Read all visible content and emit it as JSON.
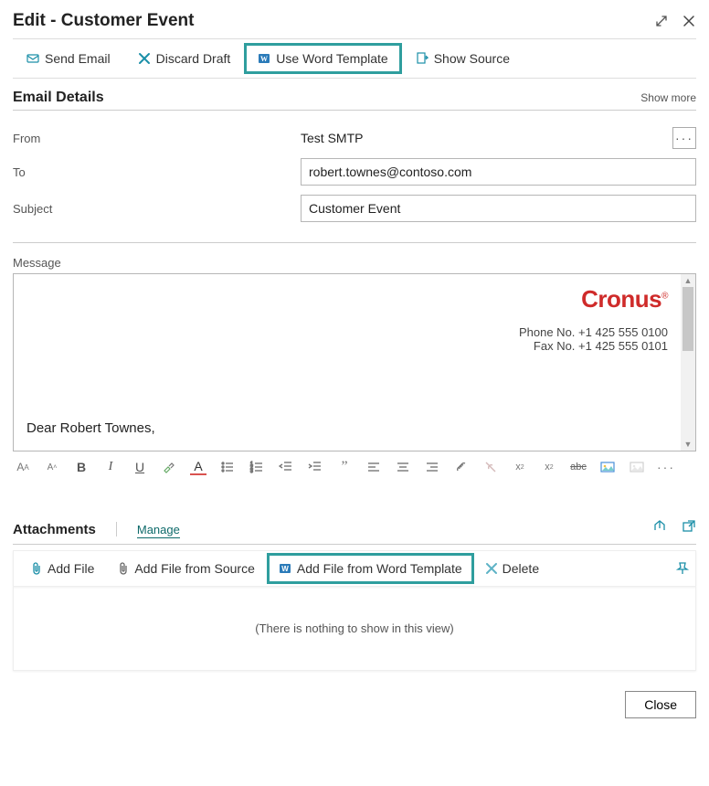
{
  "header": {
    "title": "Edit - Customer Event"
  },
  "toolbar": {
    "send_email": "Send Email",
    "discard_draft": "Discard Draft",
    "use_word_template": "Use Word Template",
    "show_source": "Show Source"
  },
  "section": {
    "title": "Email Details",
    "show_more": "Show more"
  },
  "form": {
    "from_label": "From",
    "from_value": "Test SMTP",
    "to_label": "To",
    "to_value": "robert.townes@contoso.com",
    "subject_label": "Subject",
    "subject_value": "Customer Event"
  },
  "message": {
    "label": "Message",
    "brand": "Cronus",
    "phone_line": "Phone No. +1 425 555 0100",
    "fax_line": "Fax No. +1 425 555 0101",
    "greeting": "Dear Robert Townes,"
  },
  "attachments": {
    "title": "Attachments",
    "manage": "Manage",
    "add_file": "Add File",
    "add_from_source": "Add File from Source",
    "add_word_template": "Add File from Word Template",
    "delete": "Delete",
    "empty_text": "(There is nothing to show in this view)"
  },
  "footer": {
    "close": "Close"
  }
}
